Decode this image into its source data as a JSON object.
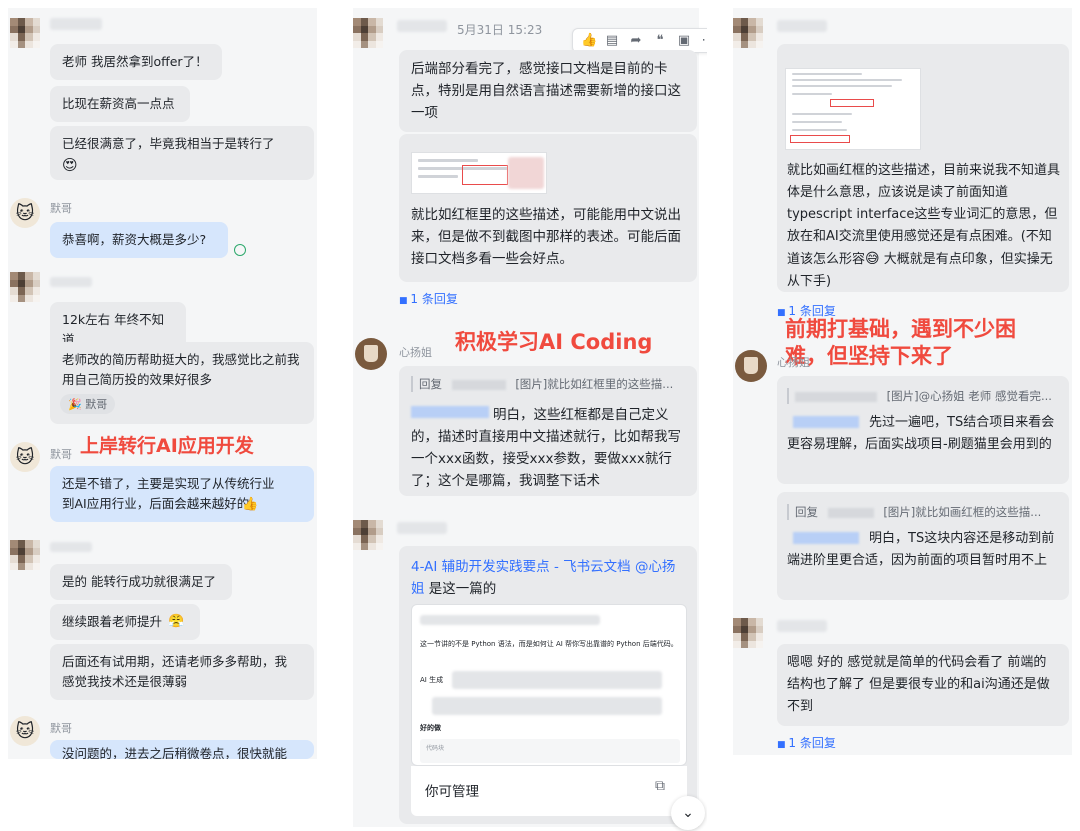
{
  "colors": {
    "accent_red": "#f04a3e",
    "link_blue": "#3370ff",
    "bubble_grey": "#e9eaec",
    "bubble_blue": "#d6e6fc"
  },
  "left": {
    "messages": [
      "老师 我居然拿到offer了！",
      "比现在薪资高一点点",
      "已经很满意了，毕竟我相当于是转行了",
      "恭喜啊，薪资大概是多少?",
      "12k左右 年终不知道",
      "老师改的简历帮助挺大的，我感觉比之前我用自己简历投的效果好很多",
      "还是不错了，主要是实现了从传统行业到AI应用行业，后面会越来越好的",
      "是的 能转行成功就很满足了",
      "继续跟着老师提升",
      "后面还有试用期，还请老师多多帮助，我感觉我技术还是很薄弱",
      "没问题的，进去之后稍微卷点，很快就能"
    ],
    "sender_moge": "默哥",
    "reaction_name": "默哥",
    "headline": "上岸转行AI应用开发"
  },
  "middle": {
    "timestamp": "5月31日 15:23",
    "messages": [
      "后端部分看完了，感觉接口文档是目前的卡点，特别是用自然语言描述需要新增的接口这一项",
      "就比如红框里的这些描述，可能能用中文说出来，但是做不到截图中那样的表述。可能后面接口文档多看一些会好点。",
      "明白，这些红框都是自己定义的，描述时直接用中文描述就行，比如帮我写一个xxx函数，接受xxx参数，要做xxx就行了；这个是哪篇，我调整下话术",
      "是这一篇的"
    ],
    "reply_count": "1 条回复",
    "sender_name": "心扬姐",
    "headline": "积极学习AI Coding",
    "quote_prefix": "回复",
    "quote_text": "[图片]就比如红框里的这些描...",
    "doc_link": "4-AI 辅助开发实践要点 - 飞书云文档",
    "doc_mention": "@心扬姐",
    "doc_line1": "这一节讲的不是 Python 语法，而是如何让 AI 帮你写出靠谱的 Python 后端代码。",
    "doc_line2": "AI 生成",
    "doc_line3": "代码块",
    "doc_bold": "好的做",
    "manage_label": "你可管理"
  },
  "right": {
    "messages": [
      "就比如画红框的这些描述，目前来说我不知道具体是什么意思，应该说是读了前面知道typescript interface这些专业词汇的意思，但放在和AI交流里使用感觉还是有点困难。(不知道该怎么形容",
      "大概就是有点印象，但实操无从下手)",
      "先过一遍吧，TS结合项目来看会更容易理解，后面实战项目-刷题猫里会用到的",
      "明白，TS这块内容还是移动到前端进阶里更合适，因为前面的项目暂时用不上",
      "嗯嗯 好的 感觉就是简单的代码会看了 前端的结构也了解了 但是要很专业的和ai沟通还是做不到"
    ],
    "reply_count": "1 条回复",
    "sender_name": "心扬姐",
    "headline_line1": "前期打基础，遇到不少困",
    "headline_line2": "难，但坚持下来了",
    "quote1_text": "[图片]@心扬姐 老师 感觉看完...",
    "quote2_prefix": "回复",
    "quote2_text": "[图片]就比如画红框的这些描..."
  }
}
